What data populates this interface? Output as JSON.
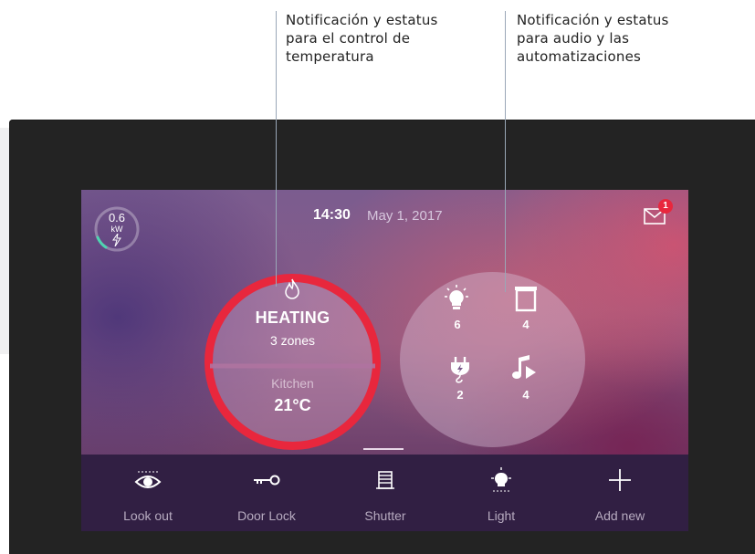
{
  "annotations": {
    "left": [
      "Notificación y estatus",
      "para el control de",
      "temperatura"
    ],
    "right": [
      "Notificación y estatus",
      "para audio y las",
      "automatizaciones"
    ]
  },
  "header": {
    "power_value": "0.6",
    "power_unit": "kW",
    "time": "14:30",
    "date": "May 1, 2017",
    "notification_count": "1"
  },
  "heating": {
    "icon": "flame-icon",
    "title": "HEATING",
    "zones": "3 zones",
    "room": "Kitchen",
    "temperature": "21°C"
  },
  "status": {
    "items": [
      {
        "icon": "lightbulb-icon",
        "count": "6"
      },
      {
        "icon": "shutter-window-icon",
        "count": "4"
      },
      {
        "icon": "plug-icon",
        "count": "2"
      },
      {
        "icon": "music-play-icon",
        "count": "4"
      }
    ]
  },
  "bottom_nav": [
    {
      "label": "Look out",
      "icon": "eye-icon"
    },
    {
      "label": "Door Lock",
      "icon": "key-icon"
    },
    {
      "label": "Shutter",
      "icon": "shutter-icon"
    },
    {
      "label": "Light",
      "icon": "light-icon"
    },
    {
      "label": "Add new",
      "icon": "plus-icon"
    }
  ],
  "colors": {
    "heating_ring": "#e8273d",
    "badge": "#e8273d",
    "gauge_accent": "#4dd5b0",
    "bottom_bar": "#311f43"
  }
}
